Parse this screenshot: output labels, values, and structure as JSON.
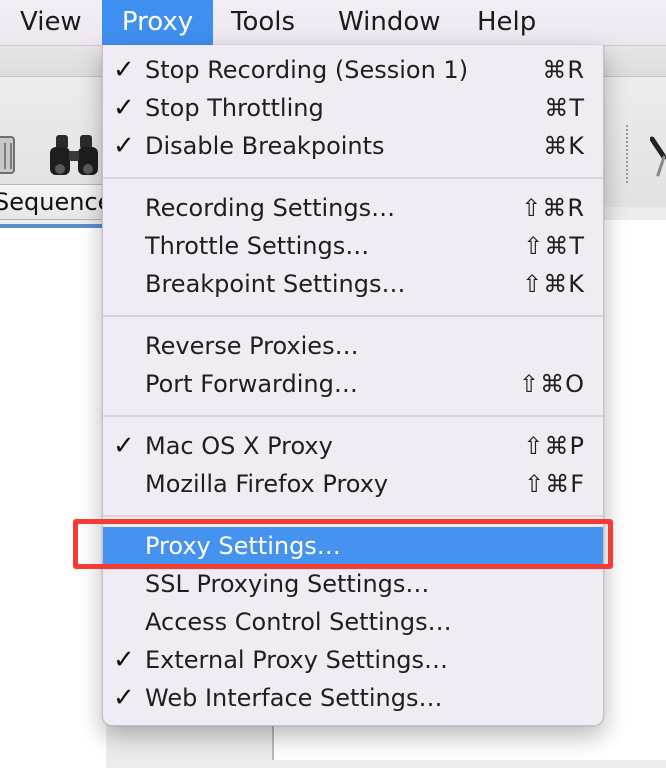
{
  "menubar": {
    "items": [
      {
        "label": "View"
      },
      {
        "label": "Proxy"
      },
      {
        "label": "Tools"
      },
      {
        "label": "Window"
      },
      {
        "label": "Help"
      }
    ],
    "active_item": "Proxy"
  },
  "toolbar": {
    "icons": [
      "trash-icon",
      "binoculars-icon",
      "tools-icon"
    ]
  },
  "sequence_header": {
    "label": "Sequence"
  },
  "proxy_menu": {
    "items": [
      {
        "check": "✓",
        "label": "Stop Recording (Session 1)",
        "shortcut": "⌘R"
      },
      {
        "check": "✓",
        "label": "Stop Throttling",
        "shortcut": "⌘T"
      },
      {
        "check": "✓",
        "label": "Disable Breakpoints",
        "shortcut": "⌘K"
      },
      {
        "check": "",
        "label": "Recording Settings…",
        "shortcut": "⇧⌘R"
      },
      {
        "check": "",
        "label": "Throttle Settings…",
        "shortcut": "⇧⌘T"
      },
      {
        "check": "",
        "label": "Breakpoint Settings…",
        "shortcut": "⇧⌘K"
      },
      {
        "check": "",
        "label": "Reverse Proxies…",
        "shortcut": ""
      },
      {
        "check": "",
        "label": "Port Forwarding…",
        "shortcut": "⇧⌘O"
      },
      {
        "check": "✓",
        "label": "Mac OS X Proxy",
        "shortcut": "⇧⌘P"
      },
      {
        "check": "",
        "label": "Mozilla Firefox Proxy",
        "shortcut": "⇧⌘F"
      },
      {
        "check": "",
        "label": "Proxy Settings…",
        "shortcut": ""
      },
      {
        "check": "",
        "label": "SSL Proxying Settings…",
        "shortcut": ""
      },
      {
        "check": "",
        "label": "Access Control Settings…",
        "shortcut": ""
      },
      {
        "check": "✓",
        "label": "External Proxy Settings…",
        "shortcut": ""
      },
      {
        "check": "✓",
        "label": "Web Interface Settings…",
        "shortcut": ""
      }
    ],
    "highlighted_item": "Proxy Settings…"
  },
  "colors": {
    "menu_highlight": "#4693ef",
    "menubar_active": "#3f8ff0",
    "annotation_red": "#f53b33"
  }
}
